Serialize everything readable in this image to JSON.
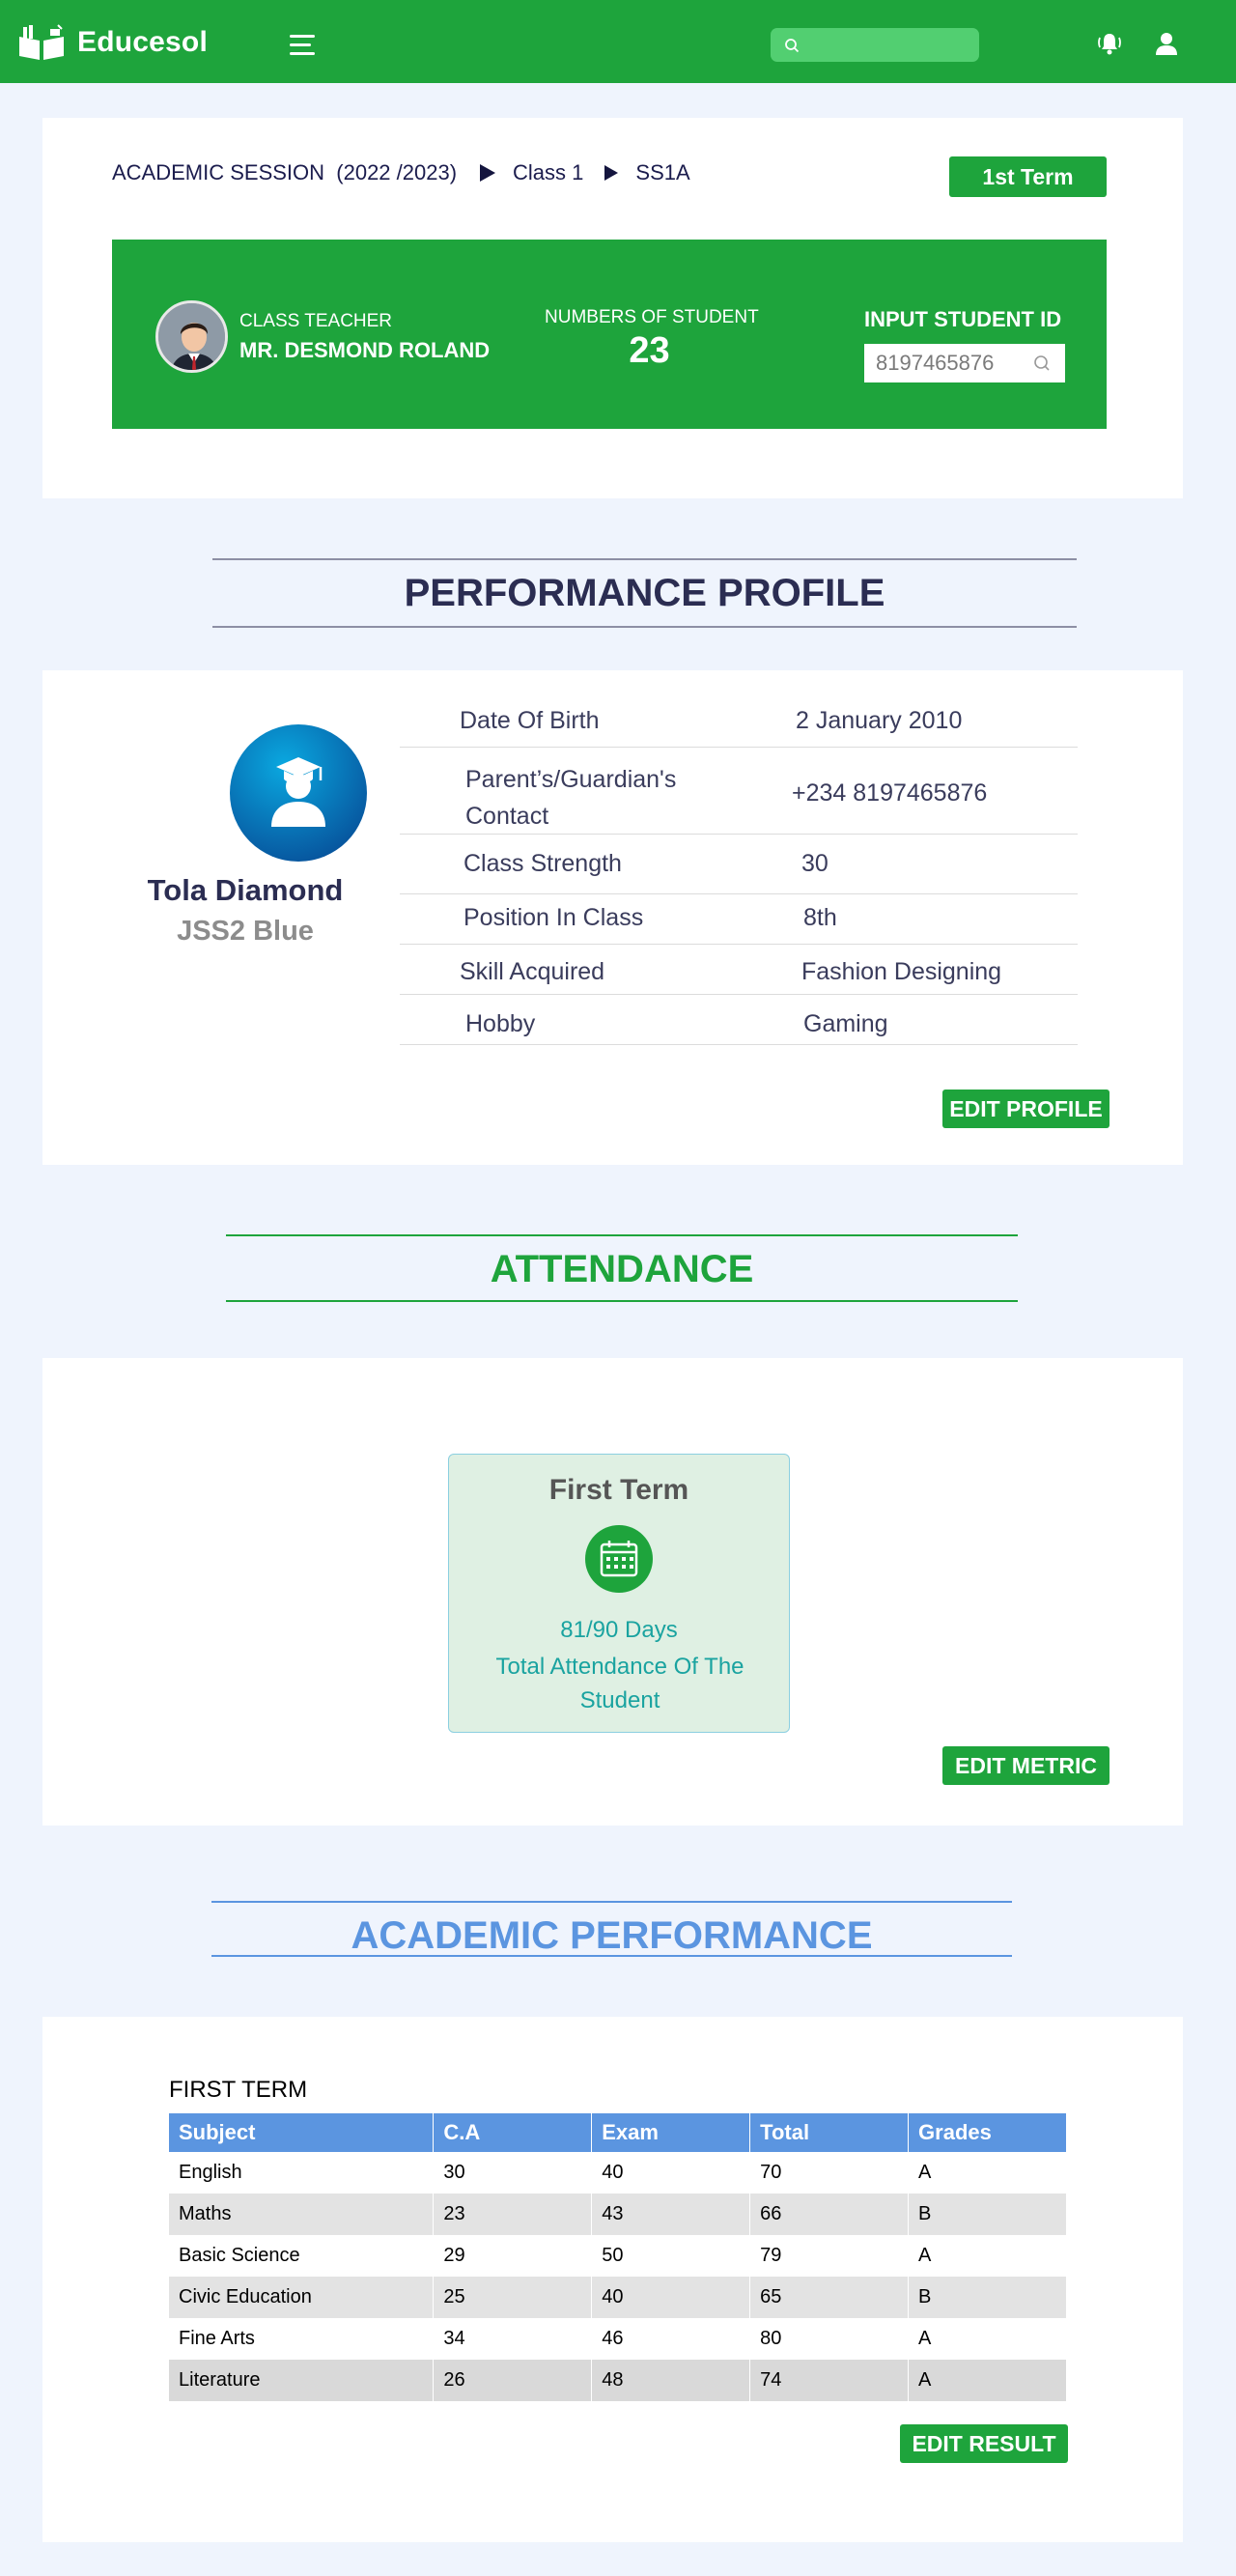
{
  "brand": {
    "name": "Educesol",
    "color": "#1ea43c"
  },
  "header": {
    "search_placeholder": "",
    "icons": [
      "menu-icon",
      "search-icon",
      "bell-icon",
      "user-icon"
    ]
  },
  "session": {
    "academic_session": "ACADEMIC SESSION  (2022 /2023)",
    "class": "Class 1",
    "arm": "SS1A",
    "term_button": "1st Term",
    "teacher_label": "CLASS TEACHER",
    "teacher_name": "MR. DESMOND ROLAND",
    "students_label": "NUMBERS OF STUDENT",
    "students_count": "23",
    "student_id_label": "INPUT STUDENT ID",
    "student_id_value": "8197465876"
  },
  "profile": {
    "section_title": "PERFORMANCE PROFILE",
    "student_name": "Tola Diamond",
    "student_class": "JSS2 Blue",
    "rows": [
      {
        "label": "Date Of Birth",
        "value": "2 January 2010"
      },
      {
        "label": "Parent’s/Guardian's Contact",
        "value": "+234 8197465876"
      },
      {
        "label": "Class Strength",
        "value": "30"
      },
      {
        "label": "Position In Class",
        "value": "8th"
      },
      {
        "label": "Skill Acquired",
        "value": "Fashion Designing"
      },
      {
        "label": "Hobby",
        "value": "Gaming"
      }
    ],
    "edit_button": "EDIT PROFILE"
  },
  "attendance": {
    "section_title": "ATTENDANCE",
    "term": "First Term",
    "days": "81/90 Days",
    "description": "Total Attendance Of The Student",
    "edit_button": "EDIT METRIC"
  },
  "academic": {
    "section_title": "ACADEMIC PERFORMANCE",
    "term": "FIRST TERM",
    "columns": [
      "Subject",
      "C.A",
      "Exam",
      "Total",
      "Grades"
    ],
    "rows": [
      [
        "English",
        "30",
        "40",
        "70",
        "A"
      ],
      [
        "Maths",
        "23",
        "43",
        "66",
        "B"
      ],
      [
        "Basic Science",
        "29",
        "50",
        "79",
        "A"
      ],
      [
        "Civic Education",
        "25",
        "40",
        "65",
        "B"
      ],
      [
        "Fine Arts",
        "34",
        "46",
        "80",
        "A"
      ],
      [
        "Literature",
        "26",
        "48",
        "74",
        "A"
      ]
    ],
    "edit_button": "EDIT RESULT"
  }
}
